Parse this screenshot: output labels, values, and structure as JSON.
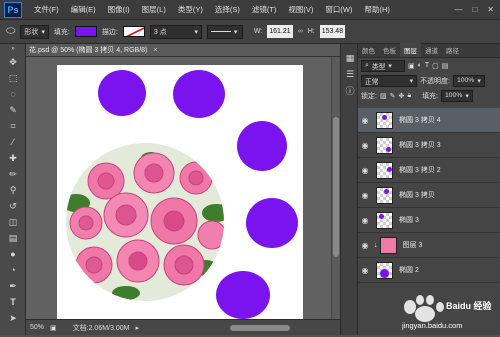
{
  "app": {
    "logo": "Ps"
  },
  "menu": [
    "文件(F)",
    "编辑(E)",
    "图像(I)",
    "图层(L)",
    "类型(Y)",
    "选择(S)",
    "滤镜(T)",
    "视图(V)",
    "窗口(W)",
    "帮助(H)"
  ],
  "window_controls": [
    "—",
    "□",
    "✕"
  ],
  "options": {
    "mode": "形状",
    "fill_label": "填充:",
    "fill_color": "#7a13ee",
    "stroke_label": "描边:",
    "stroke_width": "3 点",
    "w_label": "W:",
    "w_value": "161.21",
    "h_label": "H:",
    "h_value": "153.48"
  },
  "document": {
    "tab_title": "花.psd @ 50% (椭圆 3 拷贝 4, RGB/8)",
    "close": "×"
  },
  "status": {
    "zoom": "50%",
    "doc_info": "文档:2.06M/3.00M"
  },
  "panel": {
    "tabs": [
      "颜色",
      "色板",
      "图层",
      "通道",
      "路径"
    ],
    "filter": "类型",
    "blend_mode": "正常",
    "opacity_label": "不透明度:",
    "opacity_value": "100%",
    "lock_label": "锁定:",
    "fill_label": "填充:",
    "fill_value": "100%"
  },
  "layers": [
    {
      "name": "椭圆 3 拷贝 4",
      "selected": true
    },
    {
      "name": "椭圆 3 拷贝 3",
      "selected": false
    },
    {
      "name": "椭圆 3 拷贝 2",
      "selected": false
    },
    {
      "name": "椭圆 3 拷贝",
      "selected": false
    },
    {
      "name": "椭圆 3",
      "selected": false
    },
    {
      "name": "图层 3",
      "selected": false
    },
    {
      "name": "椭圆 2",
      "selected": false
    }
  ],
  "watermark": {
    "brand": "Baidu 经验",
    "url": "jingyan.baidu.com"
  },
  "colors": {
    "shape_purple": "#7a13ee",
    "rose_pink": "#f07aa6"
  }
}
